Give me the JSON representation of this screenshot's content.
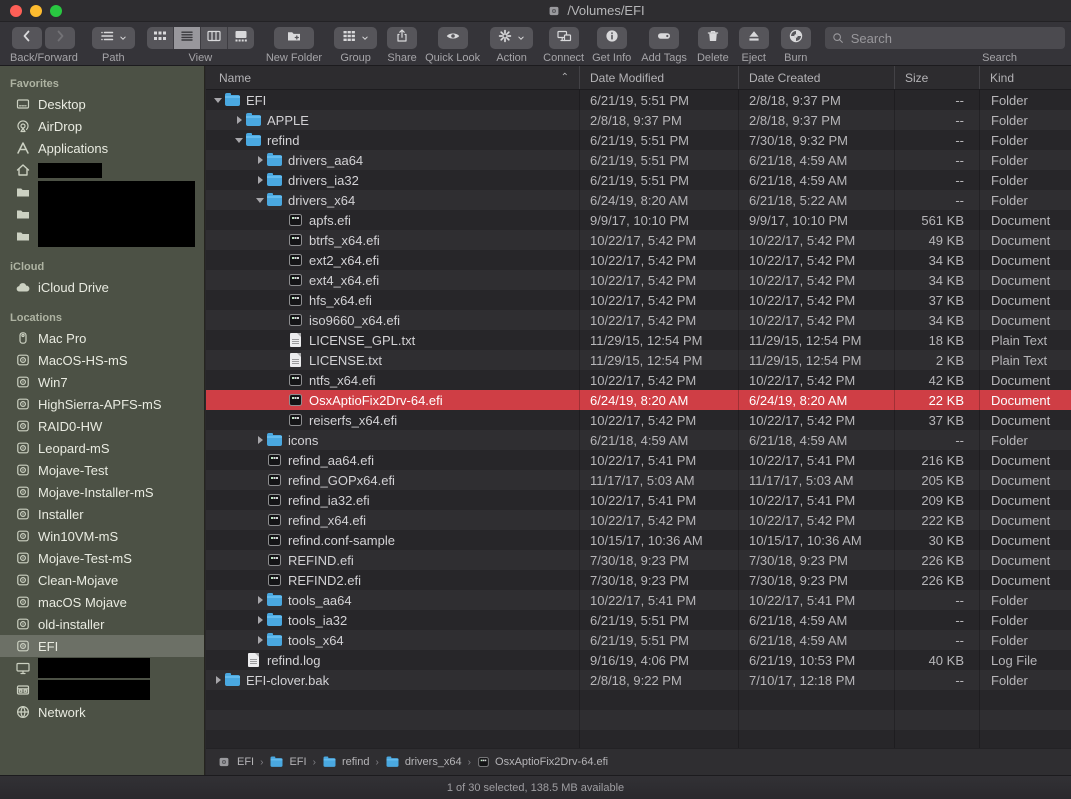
{
  "window": {
    "title": "/Volumes/EFI"
  },
  "toolbar": {
    "groups": [
      {
        "name": "back-forward",
        "label": "Back/Forward",
        "buttons": [
          {
            "icon": "chevron-left",
            "name": "back-button"
          },
          {
            "icon": "chevron-right",
            "name": "forward-button",
            "disabled": true
          }
        ]
      },
      {
        "name": "path",
        "label": "Path",
        "buttons": [
          {
            "icon": "path-list",
            "name": "path-button",
            "chevron": true
          }
        ]
      },
      {
        "name": "view",
        "label": "View",
        "segments": [
          {
            "icon": "view-grid",
            "name": "view-icons-button"
          },
          {
            "icon": "view-list",
            "name": "view-list-button",
            "selected": true
          },
          {
            "icon": "view-columns",
            "name": "view-columns-button"
          },
          {
            "icon": "view-gallery",
            "name": "view-gallery-button"
          }
        ]
      },
      {
        "name": "new-folder",
        "label": "New Folder",
        "buttons": [
          {
            "icon": "new-folder",
            "name": "new-folder-button",
            "wide": true
          }
        ]
      },
      {
        "name": "group",
        "label": "Group",
        "buttons": [
          {
            "icon": "group-grid",
            "name": "group-button",
            "chevron": true
          }
        ]
      },
      {
        "name": "share",
        "label": "Share",
        "buttons": [
          {
            "icon": "share",
            "name": "share-button"
          }
        ]
      },
      {
        "name": "quick-look",
        "label": "Quick Look",
        "buttons": [
          {
            "icon": "eye",
            "name": "quick-look-button"
          }
        ]
      },
      {
        "name": "action",
        "label": "Action",
        "buttons": [
          {
            "icon": "gear",
            "name": "action-button",
            "chevron": true
          }
        ]
      },
      {
        "name": "connect",
        "label": "Connect",
        "buttons": [
          {
            "icon": "connect",
            "name": "connect-button"
          }
        ]
      },
      {
        "name": "get-info",
        "label": "Get Info",
        "buttons": [
          {
            "icon": "info",
            "name": "get-info-button"
          }
        ]
      },
      {
        "name": "add-tags",
        "label": "Add Tags",
        "buttons": [
          {
            "icon": "tag",
            "name": "add-tags-button"
          }
        ]
      },
      {
        "name": "delete",
        "label": "Delete",
        "buttons": [
          {
            "icon": "trash",
            "name": "delete-button"
          }
        ]
      },
      {
        "name": "eject",
        "label": "Eject",
        "buttons": [
          {
            "icon": "eject",
            "name": "eject-button"
          }
        ]
      },
      {
        "name": "burn",
        "label": "Burn",
        "buttons": [
          {
            "icon": "burn",
            "name": "burn-button"
          }
        ]
      }
    ],
    "search": {
      "placeholder": "Search",
      "label": "Search"
    }
  },
  "sidebar": {
    "sections": [
      {
        "title": "Favorites",
        "items": [
          {
            "label": "Desktop",
            "icon": "desktop"
          },
          {
            "label": "AirDrop",
            "icon": "airdrop"
          },
          {
            "label": "Applications",
            "icon": "applications"
          },
          {
            "label": "",
            "icon": "home",
            "redacted": {
              "w": 64,
              "h": 15
            }
          },
          {
            "label": "",
            "icon": "folder",
            "redacted": {
              "w": 157,
              "h": 22
            }
          },
          {
            "label": "",
            "icon": "folder",
            "redacted": {
              "w": 157,
              "h": 22
            }
          },
          {
            "label": "",
            "icon": "folder",
            "redacted": {
              "w": 157,
              "h": 22
            }
          }
        ]
      },
      {
        "title": "iCloud",
        "items": [
          {
            "label": "iCloud Drive",
            "icon": "cloud"
          }
        ]
      },
      {
        "title": "Locations",
        "items": [
          {
            "label": "Mac Pro",
            "icon": "macpro"
          },
          {
            "label": "MacOS-HS-mS",
            "icon": "disk"
          },
          {
            "label": "Win7",
            "icon": "disk"
          },
          {
            "label": "HighSierra-APFS-mS",
            "icon": "disk"
          },
          {
            "label": "RAID0-HW",
            "icon": "disk"
          },
          {
            "label": "Leopard-mS",
            "icon": "disk"
          },
          {
            "label": "Mojave-Test",
            "icon": "disk"
          },
          {
            "label": "Mojave-Installer-mS",
            "icon": "disk"
          },
          {
            "label": "Installer",
            "icon": "disk"
          },
          {
            "label": "Win10VM-mS",
            "icon": "disk"
          },
          {
            "label": "Mojave-Test-mS",
            "icon": "disk"
          },
          {
            "label": "Clean-Mojave",
            "icon": "disk"
          },
          {
            "label": "macOS Mojave",
            "icon": "disk"
          },
          {
            "label": "old-installer",
            "icon": "disk"
          },
          {
            "label": "EFI",
            "icon": "disk",
            "selected": true
          },
          {
            "label": "",
            "icon": "display",
            "redacted": {
              "w": 112,
              "h": 20
            }
          },
          {
            "label": "",
            "icon": "server",
            "redacted": {
              "w": 112,
              "h": 20
            }
          },
          {
            "label": "Network",
            "icon": "globe"
          }
        ]
      }
    ]
  },
  "list": {
    "columns": [
      "Name",
      "Date Modified",
      "Date Created",
      "Size",
      "Kind"
    ],
    "sort_column": "Name",
    "rows": [
      {
        "name": "EFI",
        "depth": 0,
        "disclosure": "expanded",
        "icon": "folder",
        "modified": "6/21/19, 5:51 PM",
        "created": "2/8/18, 9:37 PM",
        "size": "--",
        "kind": "Folder"
      },
      {
        "name": "APPLE",
        "depth": 1,
        "disclosure": "collapsed",
        "icon": "folder",
        "modified": "2/8/18, 9:37 PM",
        "created": "2/8/18, 9:37 PM",
        "size": "--",
        "kind": "Folder"
      },
      {
        "name": "refind",
        "depth": 1,
        "disclosure": "expanded",
        "icon": "folder",
        "modified": "6/21/19, 5:51 PM",
        "created": "7/30/18, 9:32 PM",
        "size": "--",
        "kind": "Folder"
      },
      {
        "name": "drivers_aa64",
        "depth": 2,
        "disclosure": "collapsed",
        "icon": "folder",
        "modified": "6/21/19, 5:51 PM",
        "created": "6/21/18, 4:59 AM",
        "size": "--",
        "kind": "Folder"
      },
      {
        "name": "drivers_ia32",
        "depth": 2,
        "disclosure": "collapsed",
        "icon": "folder",
        "modified": "6/21/19, 5:51 PM",
        "created": "6/21/18, 4:59 AM",
        "size": "--",
        "kind": "Folder"
      },
      {
        "name": "drivers_x64",
        "depth": 2,
        "disclosure": "expanded",
        "icon": "folder",
        "modified": "6/24/19, 8:20 AM",
        "created": "6/21/18, 5:22 AM",
        "size": "--",
        "kind": "Folder"
      },
      {
        "name": "apfs.efi",
        "depth": 3,
        "disclosure": "none",
        "icon": "efi",
        "modified": "9/9/17, 10:10 PM",
        "created": "9/9/17, 10:10 PM",
        "size": "561 KB",
        "kind": "Document"
      },
      {
        "name": "btrfs_x64.efi",
        "depth": 3,
        "disclosure": "none",
        "icon": "efi",
        "modified": "10/22/17, 5:42 PM",
        "created": "10/22/17, 5:42 PM",
        "size": "49 KB",
        "kind": "Document"
      },
      {
        "name": "ext2_x64.efi",
        "depth": 3,
        "disclosure": "none",
        "icon": "efi",
        "modified": "10/22/17, 5:42 PM",
        "created": "10/22/17, 5:42 PM",
        "size": "34 KB",
        "kind": "Document"
      },
      {
        "name": "ext4_x64.efi",
        "depth": 3,
        "disclosure": "none",
        "icon": "efi",
        "modified": "10/22/17, 5:42 PM",
        "created": "10/22/17, 5:42 PM",
        "size": "34 KB",
        "kind": "Document"
      },
      {
        "name": "hfs_x64.efi",
        "depth": 3,
        "disclosure": "none",
        "icon": "efi",
        "modified": "10/22/17, 5:42 PM",
        "created": "10/22/17, 5:42 PM",
        "size": "37 KB",
        "kind": "Document"
      },
      {
        "name": "iso9660_x64.efi",
        "depth": 3,
        "disclosure": "none",
        "icon": "efi",
        "modified": "10/22/17, 5:42 PM",
        "created": "10/22/17, 5:42 PM",
        "size": "34 KB",
        "kind": "Document"
      },
      {
        "name": "LICENSE_GPL.txt",
        "depth": 3,
        "disclosure": "none",
        "icon": "doc",
        "modified": "11/29/15, 12:54 PM",
        "created": "11/29/15, 12:54 PM",
        "size": "18 KB",
        "kind": "Plain Text"
      },
      {
        "name": "LICENSE.txt",
        "depth": 3,
        "disclosure": "none",
        "icon": "doc",
        "modified": "11/29/15, 12:54 PM",
        "created": "11/29/15, 12:54 PM",
        "size": "2 KB",
        "kind": "Plain Text"
      },
      {
        "name": "ntfs_x64.efi",
        "depth": 3,
        "disclosure": "none",
        "icon": "efi",
        "modified": "10/22/17, 5:42 PM",
        "created": "10/22/17, 5:42 PM",
        "size": "42 KB",
        "kind": "Document"
      },
      {
        "name": "OsxAptioFix2Drv-64.efi",
        "depth": 3,
        "disclosure": "none",
        "icon": "efi",
        "modified": "6/24/19, 8:20 AM",
        "created": "6/24/19, 8:20 AM",
        "size": "22 KB",
        "kind": "Document",
        "selected": true
      },
      {
        "name": "reiserfs_x64.efi",
        "depth": 3,
        "disclosure": "none",
        "icon": "efi",
        "modified": "10/22/17, 5:42 PM",
        "created": "10/22/17, 5:42 PM",
        "size": "37 KB",
        "kind": "Document"
      },
      {
        "name": "icons",
        "depth": 2,
        "disclosure": "collapsed",
        "icon": "folder",
        "modified": "6/21/18, 4:59 AM",
        "created": "6/21/18, 4:59 AM",
        "size": "--",
        "kind": "Folder"
      },
      {
        "name": "refind_aa64.efi",
        "depth": 2,
        "disclosure": "none",
        "icon": "efi",
        "modified": "10/22/17, 5:41 PM",
        "created": "10/22/17, 5:41 PM",
        "size": "216 KB",
        "kind": "Document"
      },
      {
        "name": "refind_GOPx64.efi",
        "depth": 2,
        "disclosure": "none",
        "icon": "efi",
        "modified": "11/17/17, 5:03 AM",
        "created": "11/17/17, 5:03 AM",
        "size": "205 KB",
        "kind": "Document"
      },
      {
        "name": "refind_ia32.efi",
        "depth": 2,
        "disclosure": "none",
        "icon": "efi",
        "modified": "10/22/17, 5:41 PM",
        "created": "10/22/17, 5:41 PM",
        "size": "209 KB",
        "kind": "Document"
      },
      {
        "name": "refind_x64.efi",
        "depth": 2,
        "disclosure": "none",
        "icon": "efi",
        "modified": "10/22/17, 5:42 PM",
        "created": "10/22/17, 5:42 PM",
        "size": "222 KB",
        "kind": "Document"
      },
      {
        "name": "refind.conf-sample",
        "depth": 2,
        "disclosure": "none",
        "icon": "efi",
        "modified": "10/15/17, 10:36 AM",
        "created": "10/15/17, 10:36 AM",
        "size": "30 KB",
        "kind": "Document"
      },
      {
        "name": "REFIND.efi",
        "depth": 2,
        "disclosure": "none",
        "icon": "efi",
        "modified": "7/30/18, 9:23 PM",
        "created": "7/30/18, 9:23 PM",
        "size": "226 KB",
        "kind": "Document"
      },
      {
        "name": "REFIND2.efi",
        "depth": 2,
        "disclosure": "none",
        "icon": "efi",
        "modified": "7/30/18, 9:23 PM",
        "created": "7/30/18, 9:23 PM",
        "size": "226 KB",
        "kind": "Document"
      },
      {
        "name": "tools_aa64",
        "depth": 2,
        "disclosure": "collapsed",
        "icon": "folder",
        "modified": "10/22/17, 5:41 PM",
        "created": "10/22/17, 5:41 PM",
        "size": "--",
        "kind": "Folder"
      },
      {
        "name": "tools_ia32",
        "depth": 2,
        "disclosure": "collapsed",
        "icon": "folder",
        "modified": "6/21/19, 5:51 PM",
        "created": "6/21/18, 4:59 AM",
        "size": "--",
        "kind": "Folder"
      },
      {
        "name": "tools_x64",
        "depth": 2,
        "disclosure": "collapsed",
        "icon": "folder",
        "modified": "6/21/19, 5:51 PM",
        "created": "6/21/18, 4:59 AM",
        "size": "--",
        "kind": "Folder"
      },
      {
        "name": "refind.log",
        "depth": 1,
        "disclosure": "none",
        "icon": "doc",
        "modified": "9/16/19, 4:06 PM",
        "created": "6/21/19, 10:53 PM",
        "size": "40 KB",
        "kind": "Log File"
      },
      {
        "name": "EFI-clover.bak",
        "depth": 0,
        "disclosure": "collapsed",
        "icon": "folder",
        "modified": "2/8/18, 9:22 PM",
        "created": "7/10/17, 12:18 PM",
        "size": "--",
        "kind": "Folder"
      }
    ]
  },
  "pathbar": {
    "items": [
      {
        "label": "EFI",
        "icon": "disk-small"
      },
      {
        "label": "EFI",
        "icon": "folder"
      },
      {
        "label": "refind",
        "icon": "folder"
      },
      {
        "label": "drivers_x64",
        "icon": "folder"
      },
      {
        "label": "OsxAptioFix2Drv-64.efi",
        "icon": "efi"
      }
    ]
  },
  "statusbar": {
    "text": "1 of 30 selected, 138.5 MB available"
  },
  "colors": {
    "selection_red": "#cf3e45",
    "folder_blue": "#4aa8e0",
    "sidebar_olive": "#4c5145",
    "traffic_red": "#fe5f57",
    "traffic_yellow": "#febc2f",
    "traffic_green": "#29c841"
  }
}
